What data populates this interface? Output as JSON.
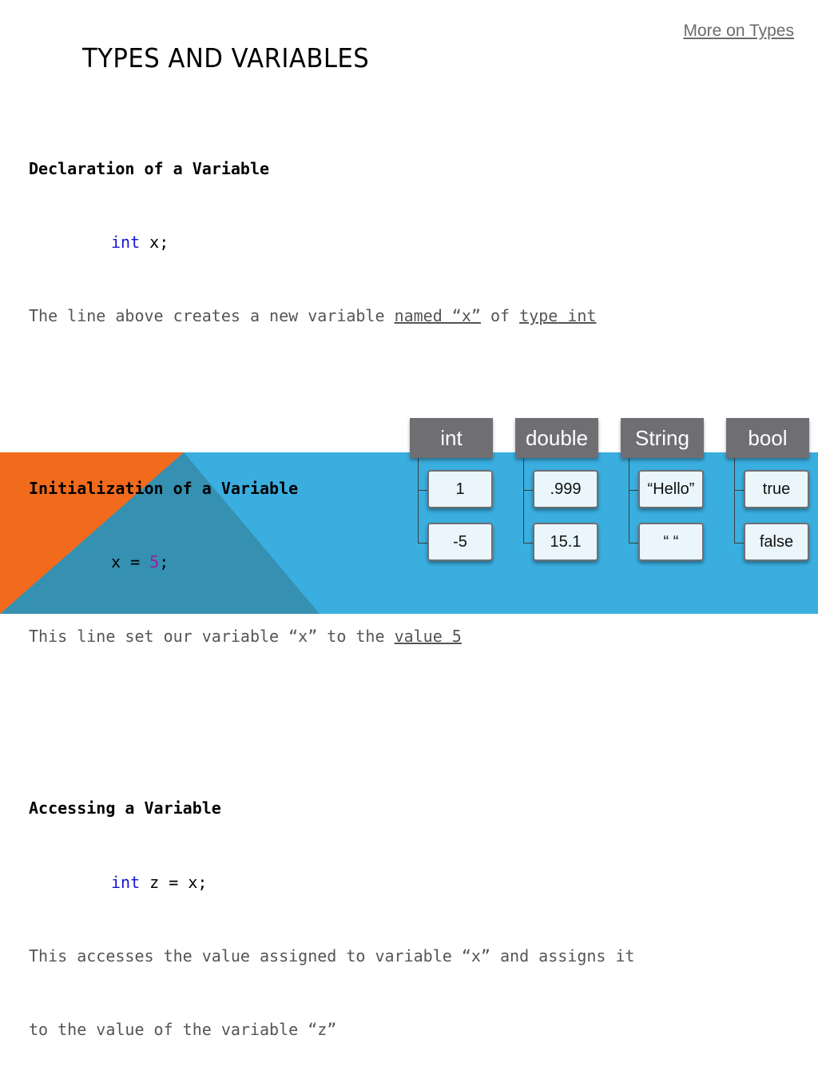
{
  "header": {
    "link_label": "More on Types",
    "title": "TYPES AND VARIABLES"
  },
  "content": {
    "declaration": {
      "heading": "Declaration of a Variable",
      "code_keyword": "int",
      "code_rest": " x;",
      "desc_prefix": "The line above creates a new variable ",
      "desc_link1": "named “x”",
      "desc_mid": " of ",
      "desc_link2": "type int"
    },
    "initialization": {
      "heading": "Initialization of a Variable",
      "code_prefix": "x = ",
      "code_number": "5",
      "code_suffix": ";",
      "desc_prefix": "This line set our variable “x” to the ",
      "desc_link": "value 5"
    },
    "accessing": {
      "heading": "Accessing a Variable",
      "code_keyword": "int",
      "code_rest": " z = x;",
      "desc_line1": "This accesses the value assigned to variable “x” and assigns it",
      "desc_line2": "to the value of the variable “z”"
    }
  },
  "types_diagram": [
    {
      "type": "int",
      "values": [
        "1",
        "-5"
      ]
    },
    {
      "type": "double",
      "values": [
        ".999",
        "15.1"
      ]
    },
    {
      "type": "String",
      "values": [
        "“Hello”",
        "“ “"
      ]
    },
    {
      "type": "bool",
      "values": [
        "true",
        "false"
      ]
    }
  ],
  "colors": {
    "keyword": "#1515d6",
    "number": "#9b1fa3",
    "band_blue": "#3aaedf",
    "band_dark_blue": "#3590b2",
    "accent_orange": "#f26b1d",
    "type_header": "#6f6f73",
    "value_box": "#eaf6fb"
  }
}
